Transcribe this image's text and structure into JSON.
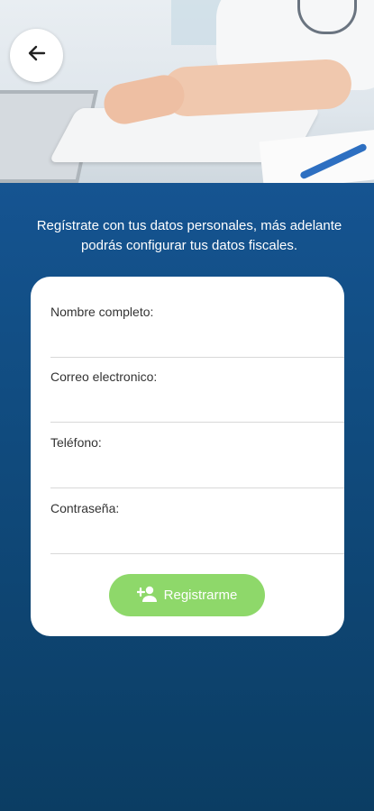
{
  "header": {
    "back_icon": "arrow-left-icon",
    "hero_image": "doctor-typing-keyboard-photo"
  },
  "intro_text": "Regístrate con tus datos personales, más adelante podrás configurar tus datos fiscales.",
  "form": {
    "fields": [
      {
        "label": "Nombre completo:",
        "value": "",
        "placeholder": ""
      },
      {
        "label": "Correo electronico:",
        "value": "",
        "placeholder": ""
      },
      {
        "label": "Teléfono:",
        "value": "",
        "placeholder": ""
      },
      {
        "label": "Contraseña:",
        "value": "",
        "placeholder": ""
      }
    ],
    "submit_label": "Registrarme",
    "submit_icon": "add-person-icon"
  },
  "colors": {
    "background_top": "#1a5aa0",
    "background_bottom": "#0b3d63",
    "button": "#8ed86a",
    "card": "#ffffff"
  }
}
